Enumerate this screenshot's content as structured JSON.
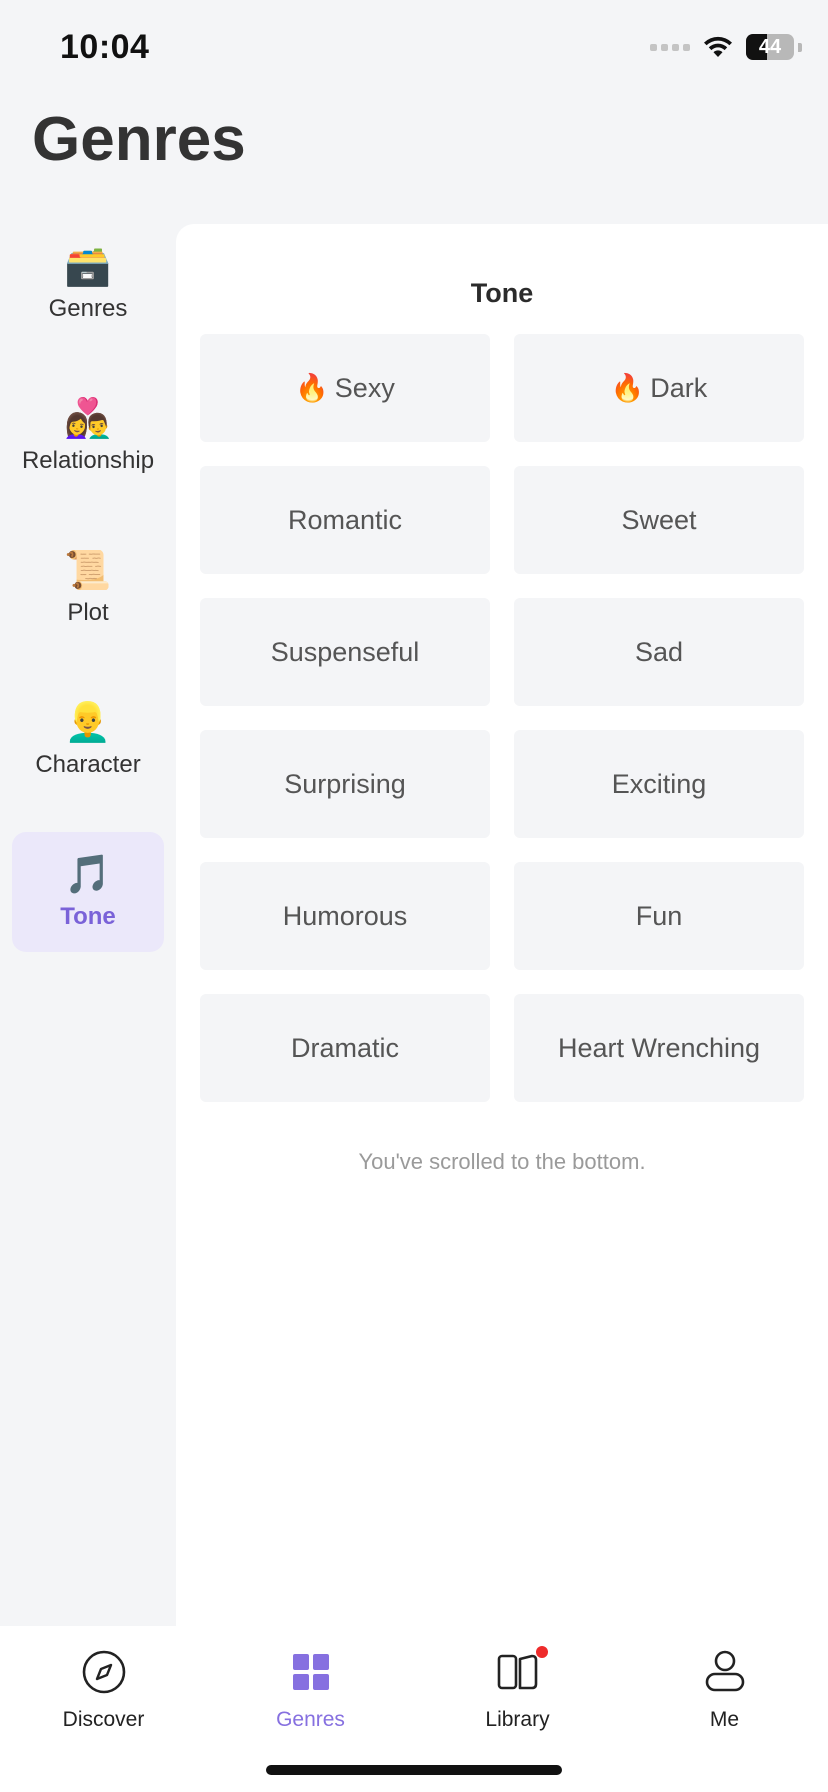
{
  "status": {
    "time": "10:04",
    "battery": "44",
    "battery_level": 0.44
  },
  "page": {
    "title": "Genres"
  },
  "sidebar": {
    "items": [
      {
        "label": "Genres",
        "emoji": "🗃️"
      },
      {
        "label": "Relationship",
        "emoji": "👩‍❤️‍👨"
      },
      {
        "label": "Plot",
        "emoji": "📜"
      },
      {
        "label": "Character",
        "emoji": "👱‍♂️"
      },
      {
        "label": "Tone",
        "emoji": "🎵",
        "active": true
      }
    ]
  },
  "panel": {
    "title": "Tone",
    "options": [
      {
        "label": "Sexy",
        "emoji": "🔥"
      },
      {
        "label": "Dark",
        "emoji": "🔥"
      },
      {
        "label": "Romantic"
      },
      {
        "label": "Sweet"
      },
      {
        "label": "Suspenseful"
      },
      {
        "label": "Sad"
      },
      {
        "label": "Surprising"
      },
      {
        "label": "Exciting"
      },
      {
        "label": "Humorous"
      },
      {
        "label": "Fun"
      },
      {
        "label": "Dramatic"
      },
      {
        "label": "Heart Wrenching"
      }
    ],
    "bottom_note": "You've scrolled to the bottom."
  },
  "tabbar": {
    "tabs": [
      {
        "label": "Discover",
        "icon": "compass-icon"
      },
      {
        "label": "Genres",
        "icon": "grid-icon",
        "active": true
      },
      {
        "label": "Library",
        "icon": "book-icon",
        "badge": true
      },
      {
        "label": "Me",
        "icon": "person-icon"
      }
    ]
  },
  "colors": {
    "accent": "#8670e0",
    "active_bg": "#ebe8fa",
    "badge": "#ee2b2b"
  }
}
